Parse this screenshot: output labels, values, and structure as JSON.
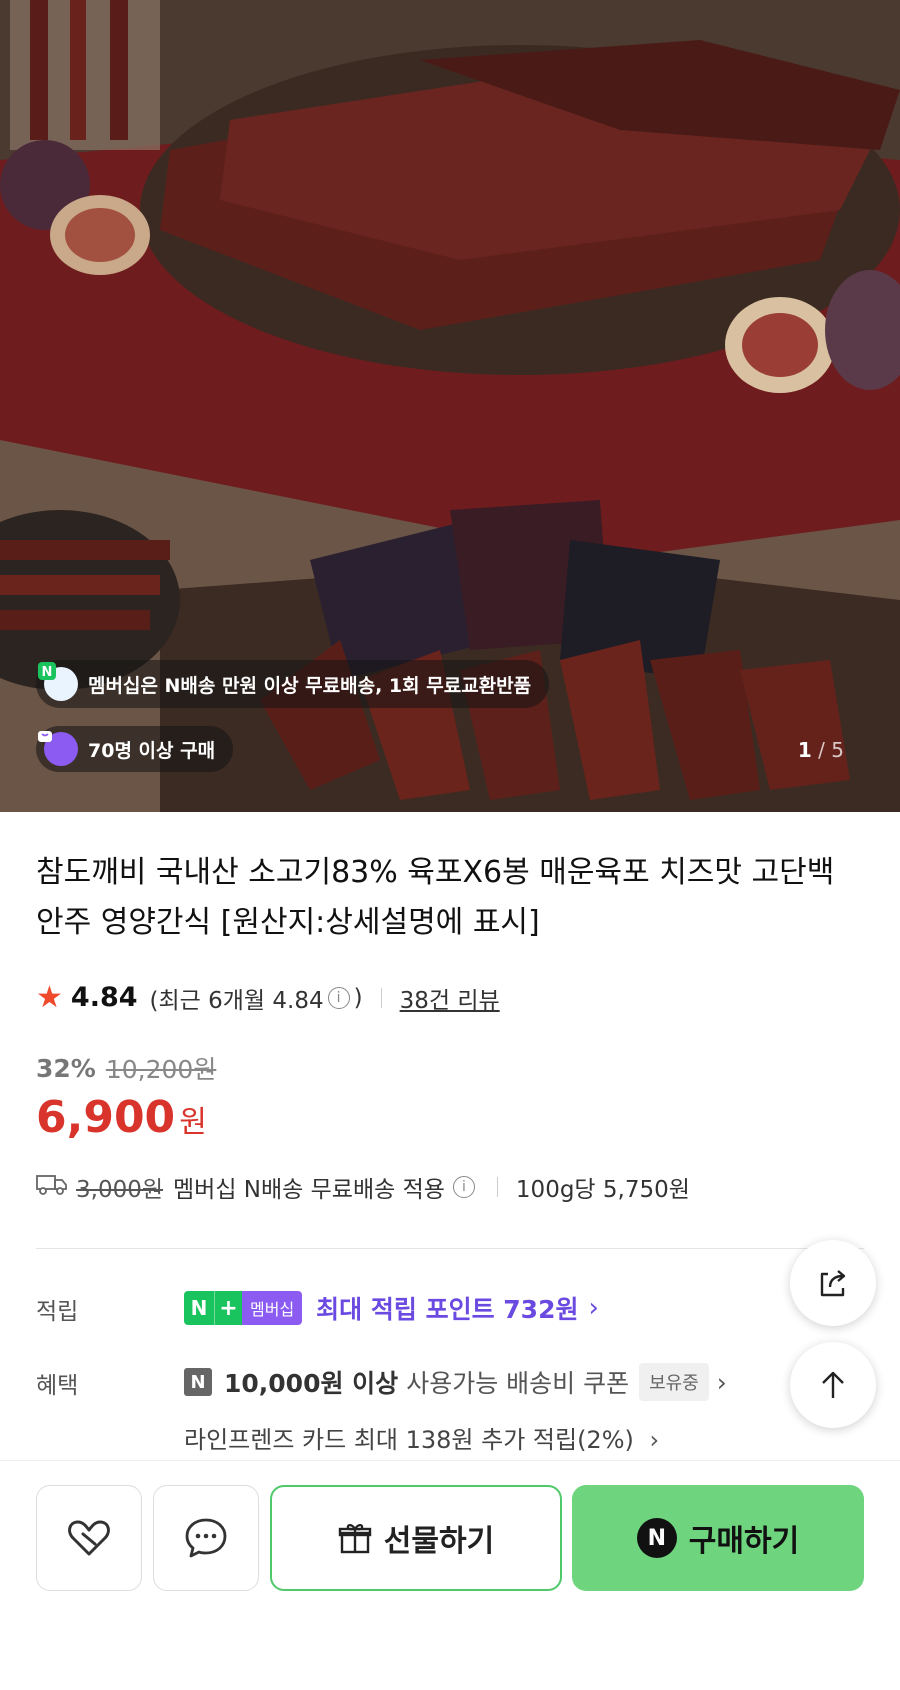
{
  "hero": {
    "membership_text": "멤버십은 N배송 만원 이상 무료배송, 1회 무료교환반품",
    "buyers_text": "70명 이상 구매",
    "image_index": "1",
    "image_total": "/ 5"
  },
  "product": {
    "title": "참도깨비 국내산 소고기83% 육포X6봉 매운육포 치즈맛 고단백 안주 영양간식 [원산지:상세설명에 표시]",
    "rating": "4.84",
    "recent_rating_prefix": "(최근 6개월 4.84",
    "recent_rating_suffix": ")",
    "review_count": "38건 리뷰",
    "discount_rate": "32%",
    "original_price": "10,200원",
    "price": "6,900",
    "price_unit": "원"
  },
  "shipping": {
    "original_fee": "3,000원",
    "text": "멤버십 N배송 무료배송 적용",
    "unit_price": "100g당 5,750원"
  },
  "points": {
    "label": "적립",
    "badge_n": "N",
    "badge_plus": "+",
    "badge_membership": "멤버십",
    "text": "최대 적립 포인트 732원"
  },
  "benefits": {
    "label": "혜택",
    "coupon_badge": "N",
    "coupon_strong": "10,000원 이상",
    "coupon_text": "사용가능 배송비 쿠폰",
    "coupon_status": "보유중",
    "card_text": "라인프렌즈 카드 최대 138원 추가 적립(2%)"
  },
  "actions": {
    "gift_label": "선물하기",
    "buy_badge": "N",
    "buy_label": "구매하기"
  },
  "colors": {
    "price_red": "#d8342b",
    "points_purple": "#6a4ae0",
    "naver_green": "#19c35d",
    "buy_green": "#6ed57e"
  },
  "icons": [
    "star-icon",
    "info-icon",
    "truck-icon",
    "share-icon",
    "arrow-up-icon",
    "heart-icon",
    "chat-icon",
    "gift-icon"
  ]
}
